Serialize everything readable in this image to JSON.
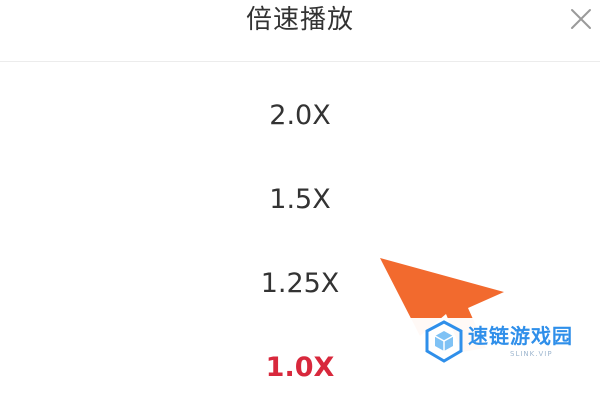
{
  "dialog": {
    "title": "倍速播放",
    "close_icon": "close-icon"
  },
  "options": [
    {
      "label": "2.0X",
      "selected": false
    },
    {
      "label": "1.5X",
      "selected": false
    },
    {
      "label": "1.25X",
      "selected": false
    },
    {
      "label": "1.0X",
      "selected": true
    }
  ],
  "watermark": {
    "text": "速链游戏园",
    "subtext": "SLINK.VIP",
    "logo_icon": "cube-logo-icon"
  },
  "colors": {
    "text": "#333333",
    "selected": "#d8283c",
    "arrow": "#f26a2e",
    "watermark": "#2f8fea"
  }
}
